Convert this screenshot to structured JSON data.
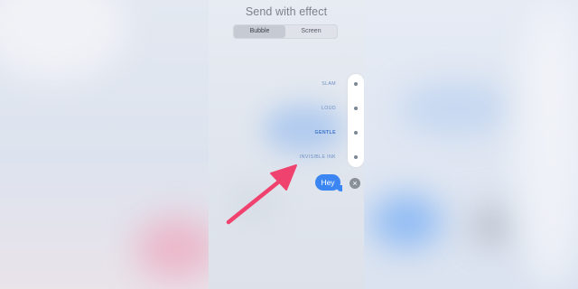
{
  "header": {
    "title": "Send with effect"
  },
  "segmented_control": {
    "options": [
      "Bubble",
      "Screen"
    ],
    "selected": "Bubble"
  },
  "bubble_effects": [
    {
      "label": "SLAM",
      "selected": false
    },
    {
      "label": "LOUD",
      "selected": false
    },
    {
      "label": "GENTLE",
      "selected": true
    },
    {
      "label": "INVISIBLE INK",
      "selected": false
    }
  ],
  "message": {
    "text": "Hey"
  },
  "icons": {
    "cancel": "close-icon",
    "annotation": "arrow-icon"
  },
  "colors": {
    "bubble": "#3b86f3",
    "arrow": "#f0426e",
    "selected_label": "#3e74c9"
  }
}
